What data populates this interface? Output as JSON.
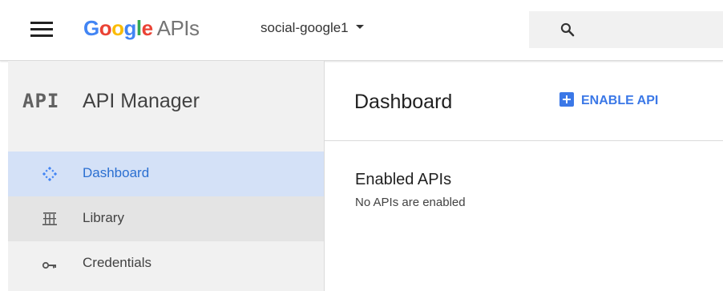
{
  "header": {
    "logo_word_letters": [
      "G",
      "o",
      "o",
      "g",
      "l",
      "e"
    ],
    "logo_product": "APIs",
    "project_name": "social-google1",
    "search_placeholder": ""
  },
  "sidebar": {
    "section_icon_text": "API",
    "section_title": "API Manager",
    "items": [
      {
        "label": "Dashboard",
        "icon": "dashboard-icon",
        "state": "selected"
      },
      {
        "label": "Library",
        "icon": "library-icon",
        "state": "hover"
      },
      {
        "label": "Credentials",
        "icon": "key-icon",
        "state": "normal"
      }
    ]
  },
  "main": {
    "title": "Dashboard",
    "enable_button_label": "ENABLE API",
    "section_title": "Enabled APIs",
    "section_subtitle": "No APIs are enabled"
  },
  "colors": {
    "accent_blue": "#3b78e7",
    "selected_bg": "#d4e1f7",
    "sidebar_bg": "#f1f1f1",
    "google_blue": "#4285f4",
    "google_red": "#ea4335",
    "google_yellow": "#fbbc05",
    "google_green": "#34a853"
  }
}
